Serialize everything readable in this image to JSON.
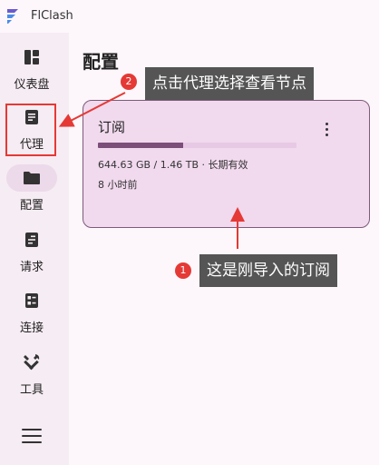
{
  "app": {
    "title": "FlClash",
    "logo_icon": "flclash-logo-icon"
  },
  "sidebar": {
    "items": [
      {
        "label": "仪表盘",
        "icon": "dashboard-icon",
        "active": false
      },
      {
        "label": "代理",
        "icon": "proxy-list-icon",
        "active": false
      },
      {
        "label": "配置",
        "icon": "folder-icon",
        "active": true
      },
      {
        "label": "请求",
        "icon": "requests-icon",
        "active": false
      },
      {
        "label": "连接",
        "icon": "connections-icon",
        "active": false
      },
      {
        "label": "工具",
        "icon": "tools-icon",
        "active": false
      }
    ],
    "menu_icon": "hamburger-menu-icon"
  },
  "page": {
    "title": "配置"
  },
  "profile_card": {
    "name": "订阅",
    "usage": "644.63 GB / 1.46 TB · 长期有效",
    "updated": "8 小时前",
    "usage_fraction": 0.43
  },
  "annotations": {
    "step1": {
      "number": "1",
      "text": "这是刚导入的订阅"
    },
    "step2": {
      "number": "2",
      "text": "点击代理选择查看节点"
    }
  },
  "colors": {
    "accent": "#7b4f7a",
    "card_bg": "#f1d9ee",
    "callout_bg": "#555555",
    "badge_red": "#e53935"
  }
}
